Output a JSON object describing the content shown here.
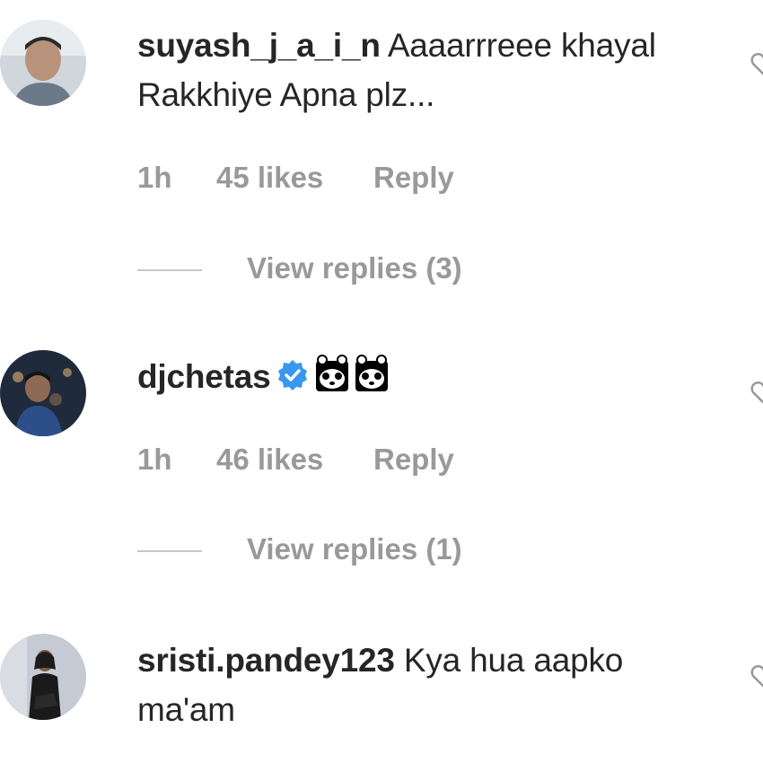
{
  "comments": [
    {
      "username": "suyash_j_a_i_n",
      "text": "Aaaarrreee khayal Rakkhiye Apna plz...",
      "time": "1h",
      "likes": "45 likes",
      "reply_label": "Reply",
      "view_replies": "View replies (3)",
      "avatar_icon": "user-avatar"
    },
    {
      "username": "djchetas",
      "verified": true,
      "verified_icon": "verified-badge-icon",
      "text_icon": "panda-face-emoji",
      "time": "1h",
      "likes": "46 likes",
      "reply_label": "Reply",
      "view_replies": "View replies (1)",
      "avatar_icon": "user-avatar"
    },
    {
      "username": "sristi.pandey123",
      "text": "Kya hua aapko ma'am",
      "avatar_icon": "user-avatar"
    }
  ],
  "colors": {
    "text": "#262626",
    "meta": "#999999",
    "verified": "#3897f0"
  }
}
